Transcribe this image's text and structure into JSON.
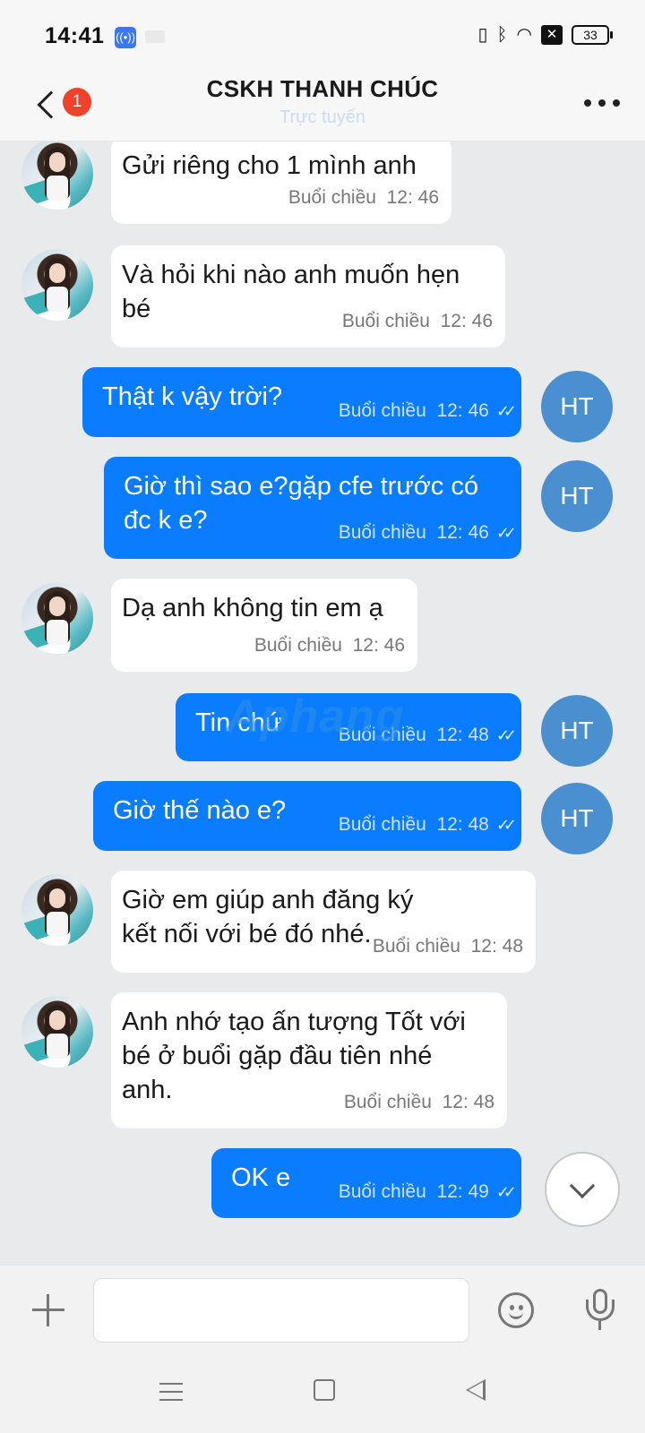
{
  "status_bar": {
    "time": "14:41",
    "battery": "33",
    "icons": [
      "vibrate-icon",
      "bluetooth-icon",
      "wifi-icon",
      "close-box-icon",
      "battery-icon"
    ]
  },
  "header": {
    "title": "CSKH THANH CHÚC",
    "subtitle": "Trực tuyến",
    "back_badge": "1"
  },
  "watermark": {
    "part1": "Aphang",
    "part2": ""
  },
  "messages": [
    {
      "from": "them",
      "text": "Gửi riêng cho 1 mình anh",
      "period": "Buổi chiều",
      "time": "12: 46"
    },
    {
      "from": "them",
      "text": "Và hỏi khi nào anh muốn hẹn bé",
      "period": "Buổi chiều",
      "time": "12: 46"
    },
    {
      "from": "me",
      "text": "Thật k vậy trời?",
      "period": "Buổi chiều",
      "time": "12: 46",
      "avatar": "HT"
    },
    {
      "from": "me",
      "text": "Giờ thì sao e?gặp cfe trước có đc k e?",
      "period": "Buổi chiều",
      "time": "12: 46",
      "avatar": "HT"
    },
    {
      "from": "them",
      "text": "Dạ anh không tin em ạ",
      "period": "Buổi chiều",
      "time": "12: 46"
    },
    {
      "from": "me",
      "text": "Tin chứ",
      "period": "Buổi chiều",
      "time": "12: 48",
      "avatar": "HT"
    },
    {
      "from": "me",
      "text": "Giờ thế nào e?",
      "period": "Buổi chiều",
      "time": "12: 48",
      "avatar": "HT"
    },
    {
      "from": "them",
      "text": "Giờ em giúp anh đăng ký kết nối với bé đó nhé.",
      "period": "Buổi chiều",
      "time": "12: 48"
    },
    {
      "from": "them",
      "text": "Anh nhớ tạo ấn tượng Tốt với bé ở buổi gặp đầu tiên nhé anh.",
      "period": "Buổi chiều",
      "time": "12: 48"
    },
    {
      "from": "me",
      "text": "OK e",
      "period": "Buổi chiều",
      "time": "12: 49"
    }
  ],
  "composer": {
    "value": "",
    "placeholder": ""
  },
  "colors": {
    "out_bubble": "#0a7cff",
    "in_bubble": "#ffffff",
    "chat_bg": "#e9eaec",
    "badge": "#f0412b",
    "ht_avatar": "#4a8fd0"
  }
}
